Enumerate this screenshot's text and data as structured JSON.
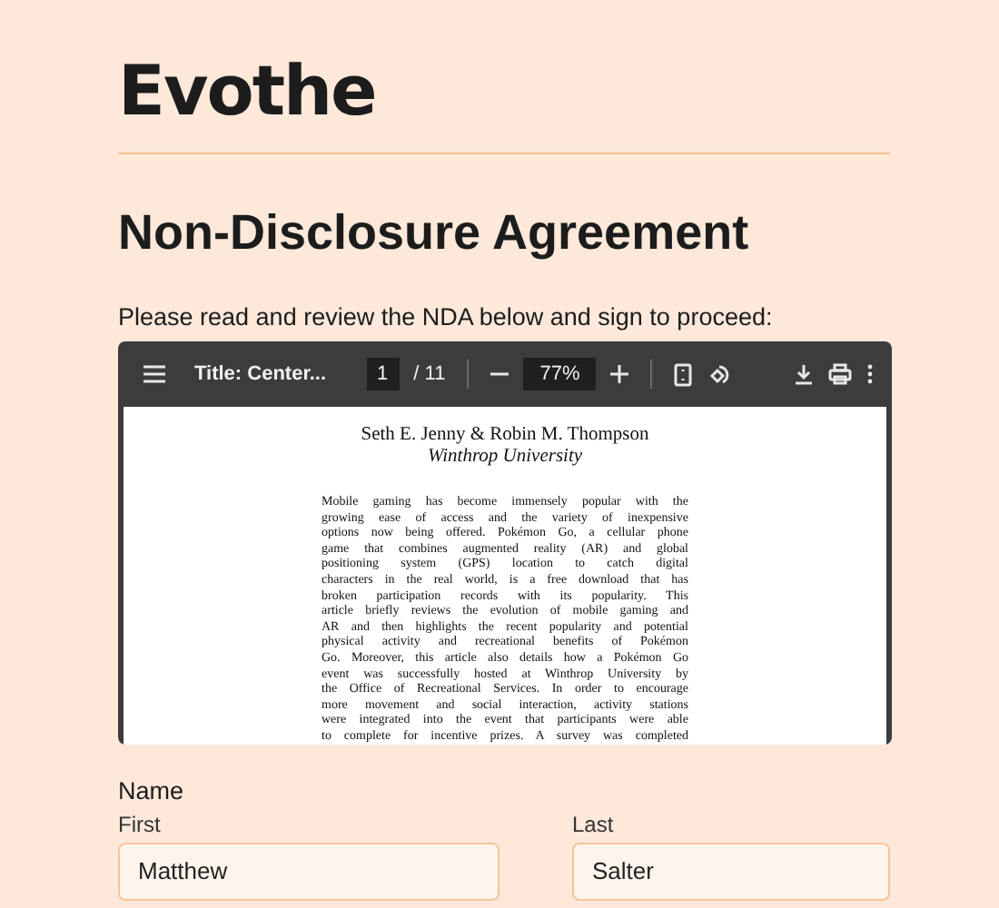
{
  "logo": "Evothe",
  "heading": "Non-Disclosure Agreement",
  "intro": "Please read and review the NDA below and sign to proceed:",
  "pdf_viewer": {
    "title": "Title: Center...",
    "page": "1",
    "page_count": "/ 11",
    "zoom": "77%",
    "document": {
      "authors": "Seth E. Jenny & Robin M. Thompson",
      "affiliation": "Winthrop University",
      "lines": [
        "Mobile gaming has become immensely popular with the",
        "growing ease of access and the variety of inexpensive",
        "options now being offered.  Pokémon Go, a cellular phone",
        "game that combines augmented reality (AR) and global",
        "positioning system (GPS) location to catch digital",
        "characters in the real world, is a free download that has",
        "broken participation records with its popularity.  This",
        "article briefly reviews the evolution of mobile gaming and",
        "AR and then highlights the recent popularity and potential",
        "physical activity and recreational benefits of Pokémon",
        "Go. Moreover, this article also details how a Pokémon Go",
        "event was successfully hosted at Winthrop University by",
        "the Office of Recreational Services. In order to encourage",
        "more movement and social interaction, activity stations",
        "were integrated into the event that participants were able",
        "to complete for incentive prizes. A survey was completed"
      ]
    }
  },
  "name_section": {
    "label": "Name",
    "fields": [
      {
        "label": "First",
        "value": "Matthew"
      },
      {
        "label": "Last",
        "value": "Salter"
      }
    ]
  }
}
